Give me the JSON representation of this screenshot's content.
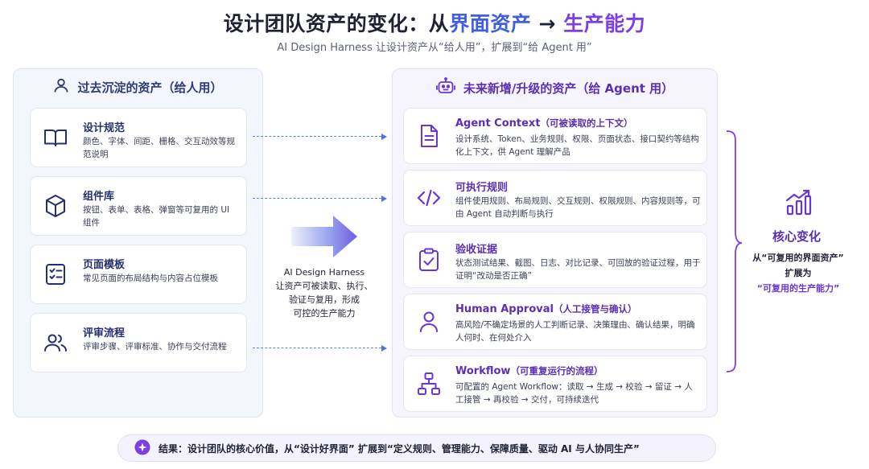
{
  "title": {
    "part1": "设计团队资产的变化：从",
    "part2": "界面资产",
    "arrow": " → ",
    "part3": "生产能力"
  },
  "subtitle": "AI Design Harness 让设计资产从“给人用”，扩展到“给 Agent 用”",
  "left_panel": {
    "heading": "过去沉淀的资产（给人用）",
    "icon": "user-icon",
    "cards": [
      {
        "title": "设计规范",
        "desc": "颜色、字体、间距、栅格、交互动效等规范说明",
        "icon": "book-icon"
      },
      {
        "title": "组件库",
        "desc": "按钮、表单、表格、弹窗等可复用的 UI 组件",
        "icon": "cube-icon"
      },
      {
        "title": "页面模板",
        "desc": "常见页面的布局结构与内容占位模板",
        "icon": "checklist-icon"
      },
      {
        "title": "评审流程",
        "desc": "评审步骤、评审标准、协作与交付流程",
        "icon": "users-icon"
      }
    ]
  },
  "center": {
    "text_line1": "AI Design Harness",
    "text_line2": "让资产可被读取、执行、",
    "text_line3": "验证与复用，形成",
    "text_line4": "可控的生产能力"
  },
  "right_panel": {
    "heading": "未来新增/升级的资产（给 Agent 用）",
    "icon": "robot-icon",
    "cards": [
      {
        "title": "Agent Context",
        "note": "（可被读取的上下文）",
        "desc": "设计系统、Token、业务规则、权限、页面状态、接口契约等结构化上下文，供 Agent 理解产品",
        "icon": "document-icon"
      },
      {
        "title": "可执行规则",
        "note": "",
        "desc": "组件使用规则、布局规则、交互规则、权限规则、内容规则等，可由 Agent 自动判断与执行",
        "icon": "code-icon"
      },
      {
        "title": "验收证据",
        "note": "",
        "desc": "状态测试结果、截图、日志、对比记录、可回放的验证过程，用于证明“改动是否正确”",
        "icon": "clipboard-check-icon"
      },
      {
        "title": "Human Approval",
        "note": "（人工接管与确认）",
        "desc": "高风险/不确定场景的人工判断记录、决策理由、确认结果，明确人何时、在何处介入",
        "icon": "person-icon"
      },
      {
        "title": "Workflow",
        "note": "（可重复运行的流程）",
        "desc": "可配置的 Agent Workflow：读取 → 生成 → 校验 → 留证 → 人工接管 → 再校验 → 交付，可持续迭代",
        "icon": "workflow-icon"
      }
    ]
  },
  "core": {
    "title": "核心变化",
    "line1": "从“可复用的界面资产”",
    "line2": "扩展为",
    "line3": "“可复用的生产能力”",
    "icon": "growth-chart-icon"
  },
  "bottom": {
    "text": "结果：设计团队的核心价值，从“设计好界面” 扩展到“定义规则、管理能力、保障质量、驱动 AI 与人协同生产”",
    "icon": "sparkle-icon"
  },
  "colors": {
    "blue": "#3f5fe0",
    "purple": "#7b3fe4",
    "dark": "#1f2235"
  }
}
